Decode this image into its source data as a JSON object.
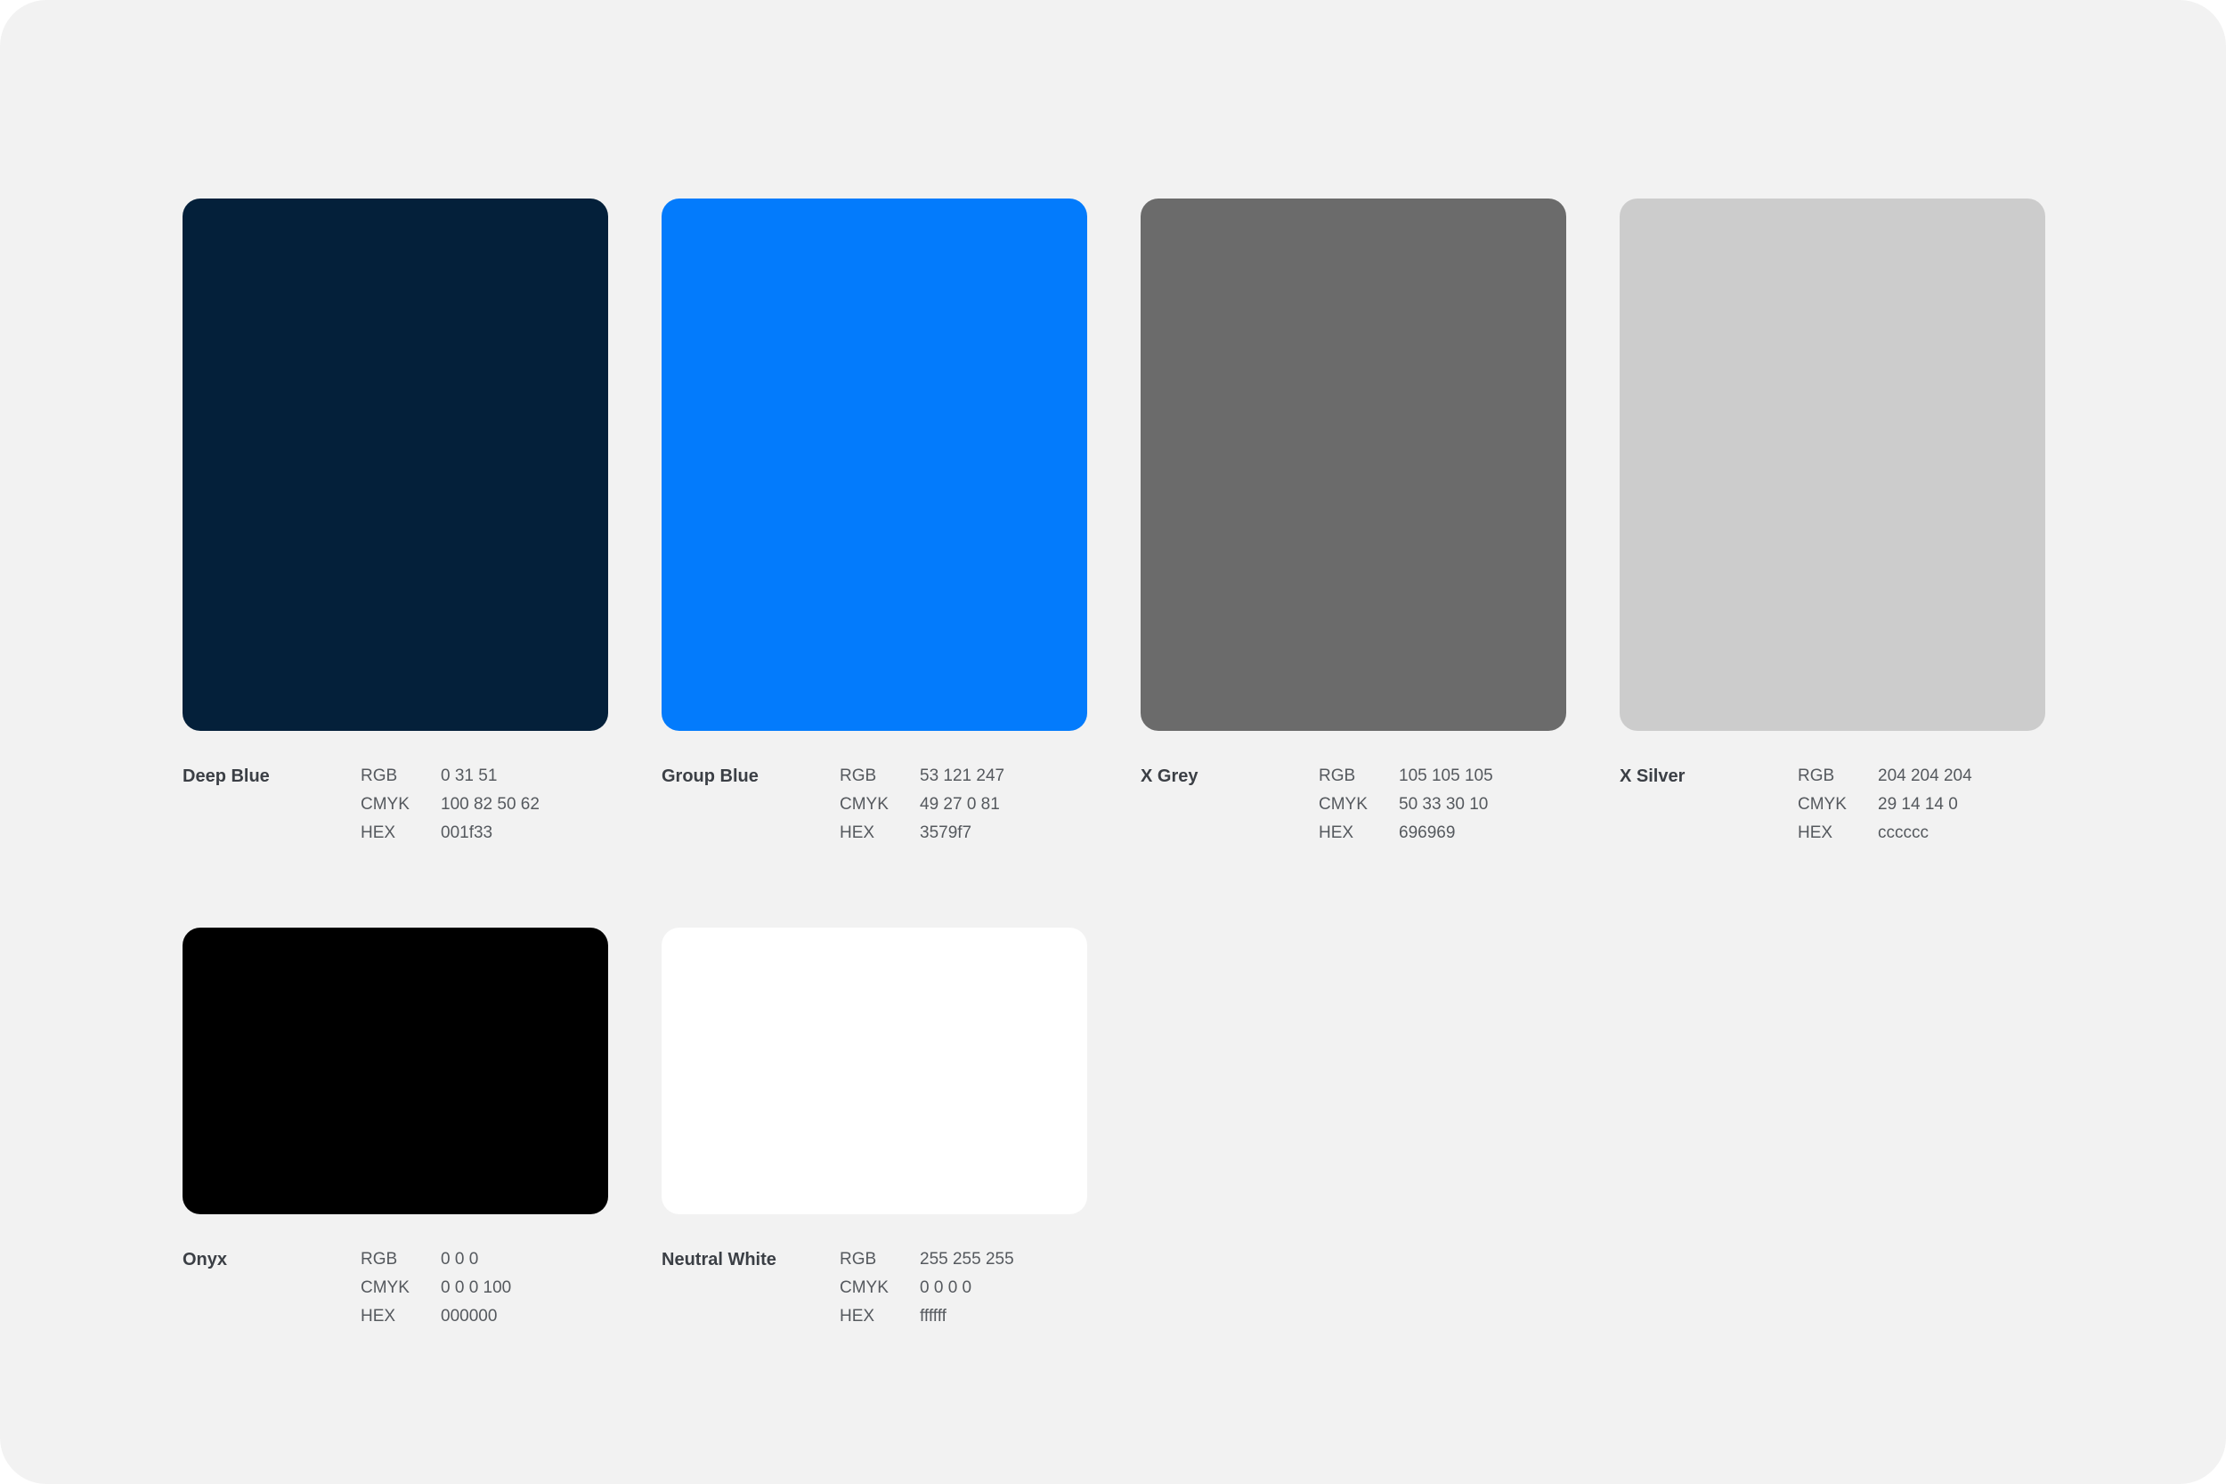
{
  "labels": {
    "rgb": "RGB",
    "cmyk": "CMYK",
    "hex": "HEX"
  },
  "swatches": [
    {
      "name": "Deep Blue",
      "color": "#001f33",
      "rgb": "0 31 51",
      "cmyk": "100 82 50 62",
      "hex": "001f33"
    },
    {
      "name": "Group Blue",
      "color": "#3579f7",
      "rgb": "53 121 247",
      "cmyk": "49 27 0 81",
      "hex": "3579f7"
    },
    {
      "name": "X Grey",
      "color": "#696969",
      "rgb": "105 105 105",
      "cmyk": "50 33 30 10",
      "hex": "696969"
    },
    {
      "name": "X Silver",
      "color": "#cccccc",
      "rgb": "204 204 204",
      "cmyk": "29 14 14 0",
      "hex": "cccccc"
    },
    {
      "name": "Onyx",
      "color": "#000000",
      "rgb": "0 0 0",
      "cmyk": "0 0 0 100",
      "hex": "000000"
    },
    {
      "name": "Neutral White",
      "color": "#ffffff",
      "rgb": "255 255 255",
      "cmyk": "0 0 0 0",
      "hex": "ffffff"
    }
  ]
}
